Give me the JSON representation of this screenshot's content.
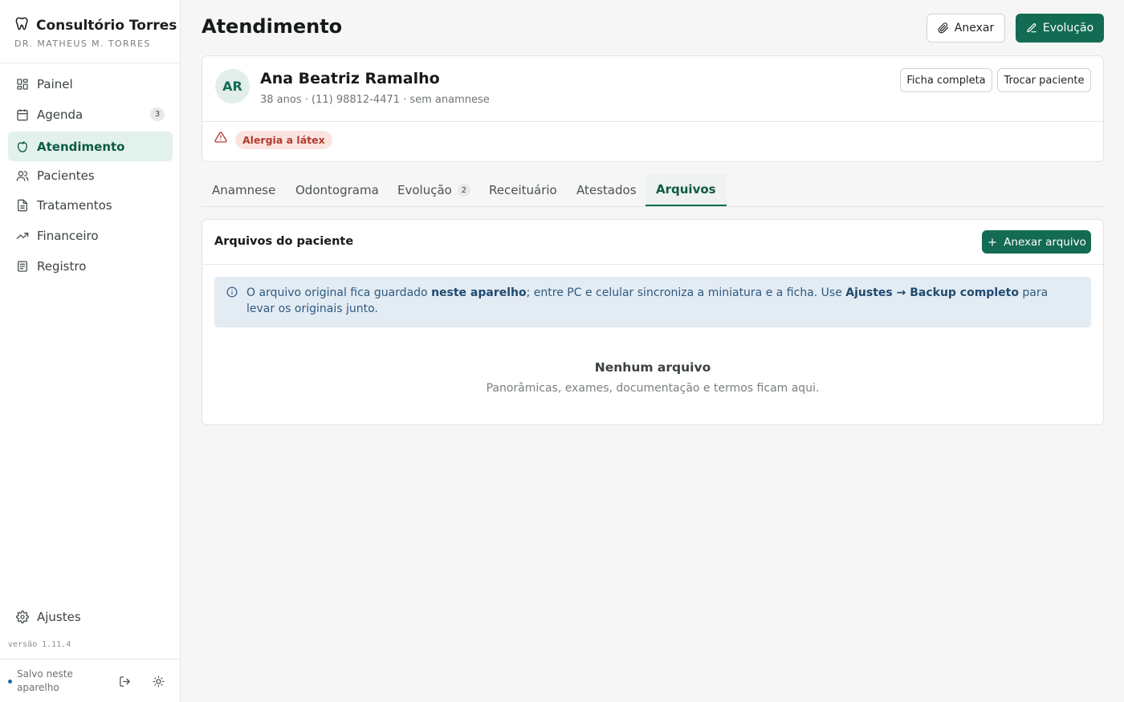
{
  "sidebar": {
    "brand_name": "Consultório Torres",
    "brand_sub": "DR. MATHEUS M. TORRES",
    "items": [
      {
        "label": "Painel",
        "icon": "grid-icon"
      },
      {
        "label": "Agenda",
        "icon": "calendar-icon",
        "badge": "3"
      },
      {
        "label": "Atendimento",
        "icon": "tooth-icon",
        "active": true
      },
      {
        "label": "Pacientes",
        "icon": "users-icon"
      },
      {
        "label": "Tratamentos",
        "icon": "document-icon"
      },
      {
        "label": "Financeiro",
        "icon": "trend-icon"
      },
      {
        "label": "Registro",
        "icon": "list-icon"
      }
    ],
    "settings_label": "Ajustes",
    "version": "versão 1.11.4",
    "save_status": "Salvo neste aparelho"
  },
  "header": {
    "title": "Atendimento",
    "attach_label": "Anexar",
    "evolution_label": "Evolução"
  },
  "patient": {
    "initials": "AR",
    "name": "Ana Beatriz Ramalho",
    "meta": "38 anos · (11) 98812-4471 · sem anamnese",
    "full_record_label": "Ficha completa",
    "switch_label": "Trocar paciente",
    "allergy": "Alergia a látex"
  },
  "tabs": [
    {
      "label": "Anamnese"
    },
    {
      "label": "Odontograma"
    },
    {
      "label": "Evolução",
      "badge": "2"
    },
    {
      "label": "Receituário"
    },
    {
      "label": "Atestados"
    },
    {
      "label": "Arquivos",
      "active": true
    }
  ],
  "files": {
    "title": "Arquivos do paciente",
    "attach_file_label": "Anexar arquivo",
    "info_part1": "O arquivo original fica guardado ",
    "info_bold1": "neste aparelho",
    "info_part2": "; entre PC e celular sincroniza a miniatura e a ficha. Use ",
    "info_bold2": "Ajustes → Backup completo",
    "info_part3": " para levar os originais junto.",
    "empty_title": "Nenhum arquivo",
    "empty_sub": "Panorâmicas, exames, documentação e termos ficam aqui."
  },
  "colors": {
    "primary": "#136b53",
    "active_bg": "#e3f1ec",
    "alert": "#b33b2f",
    "info_bg": "#e3ebf3",
    "info_text": "#2d5a80"
  }
}
